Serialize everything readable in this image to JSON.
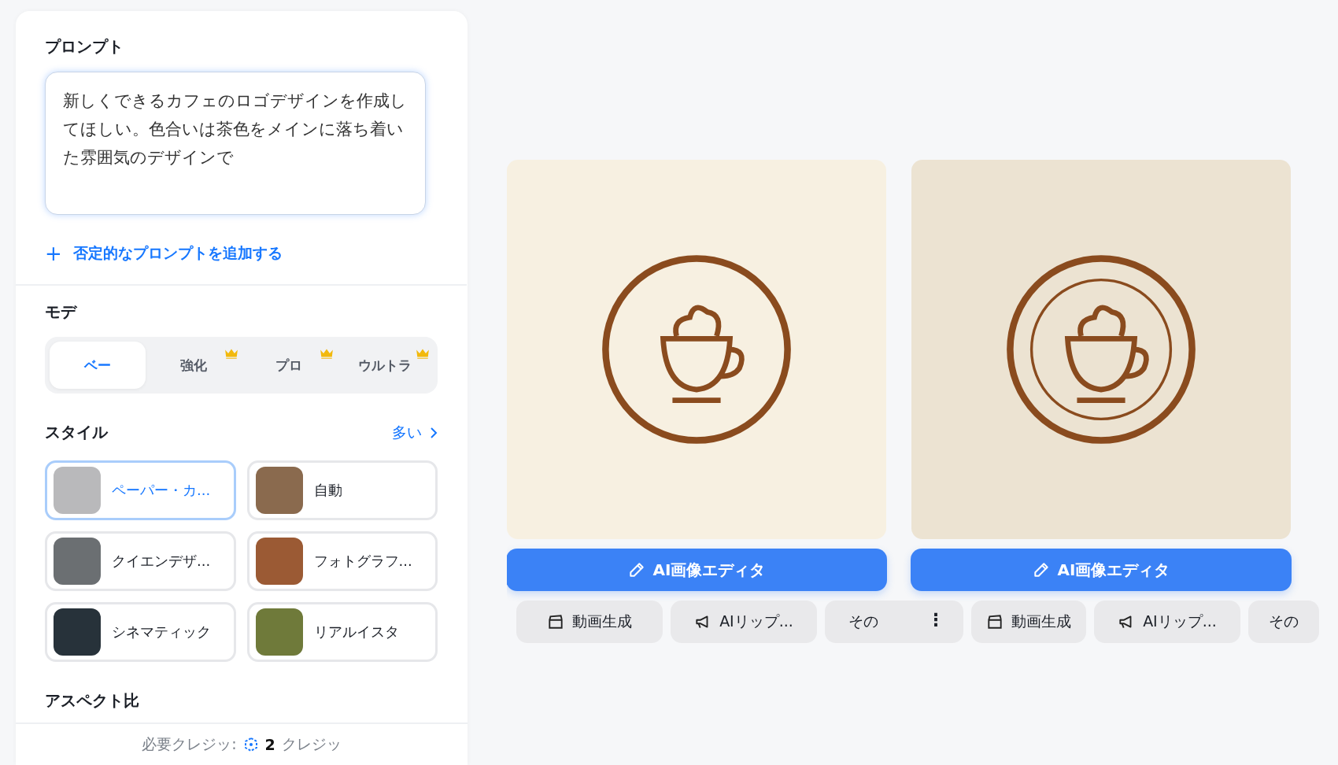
{
  "prompt": {
    "label": "プロンプト",
    "value": "新しくできるカフェのロゴデザインを作成してほしい。色合いは茶色をメインに落ち着いた雰囲気のデザインで",
    "add_negative": {
      "icon": "+",
      "label": "否定的なプロンプトを追加する"
    }
  },
  "mode": {
    "label": "モデ",
    "options": [
      {
        "label": "ベー",
        "selected": true,
        "premium": false
      },
      {
        "label": "強化",
        "selected": false,
        "premium": true
      },
      {
        "label": "プロ",
        "selected": false,
        "premium": true
      },
      {
        "label": "ウルトラ",
        "selected": false,
        "premium": true
      }
    ]
  },
  "style": {
    "label": "スタイル",
    "more": "多い",
    "items": [
      {
        "label": "ペーパー・カ...",
        "selected": true
      },
      {
        "label": "自動",
        "selected": false
      },
      {
        "label": "クイエンデザ...",
        "selected": false
      },
      {
        "label": "フォトグラフ...",
        "selected": false
      },
      {
        "label": "シネマティック",
        "selected": false
      },
      {
        "label": "リアルイスタ",
        "selected": false
      }
    ]
  },
  "aspect_label": "アスペクト比",
  "credits": {
    "label": "必要クレジッ:",
    "amount": "2",
    "unit": "クレジッ"
  },
  "results": [
    {
      "editor_button": "AI画像エディタ",
      "actions": [
        "動画生成",
        "AIリップ...",
        "その"
      ],
      "menu_icon": "⋮"
    },
    {
      "editor_button": "AI画像エディタ",
      "actions": [
        "動画生成",
        "AIリップ...",
        "その"
      ]
    }
  ]
}
